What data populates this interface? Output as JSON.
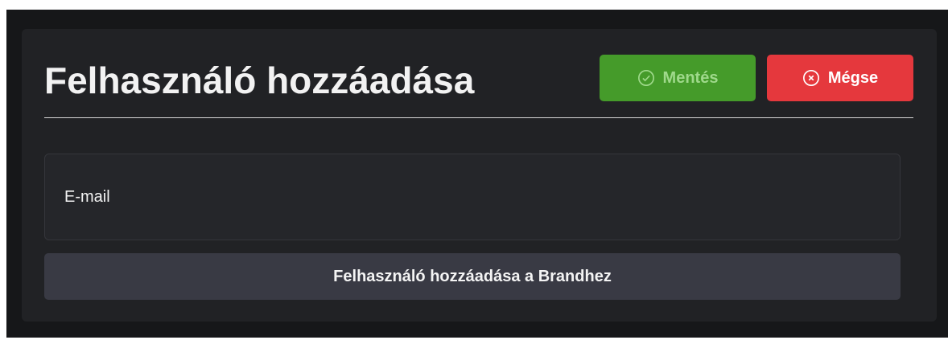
{
  "header": {
    "title": "Felhasználó hozzáadása",
    "save_label": "Mentés",
    "cancel_label": "Mégse",
    "save_icon": "check-circle-icon",
    "cancel_icon": "x-circle-icon"
  },
  "form": {
    "email_label": "E-mail",
    "submit_label": "Felhasználó hozzáadása a Brandhez"
  },
  "colors": {
    "save": "#459b2a",
    "cancel": "#e5383d",
    "card": "#212225",
    "button": "#393a44"
  }
}
